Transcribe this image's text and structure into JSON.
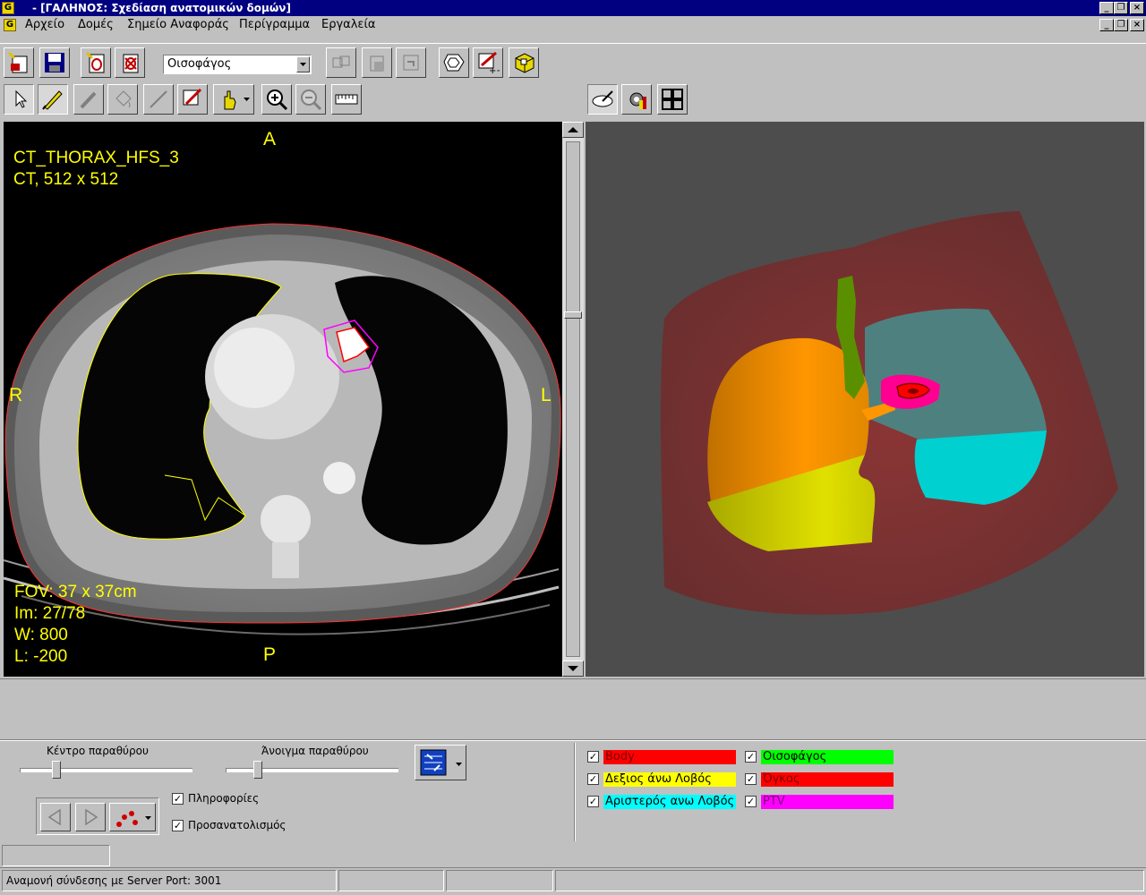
{
  "window": {
    "title": "- [ΓΑΛΗΝΟΣ: Σχεδίαση ανατομικών δομών]"
  },
  "menu": [
    "Αρχείο",
    "Δομές",
    "Σημείο Αναφοράς",
    "Περίγραμμα",
    "Εργαλεία"
  ],
  "toolbar": {
    "structure_select": "Οισοφάγος"
  },
  "ct_view": {
    "series": "CT_THORAX_HFS_3",
    "info": "CT, 512 x 512",
    "orient_top": "A",
    "orient_bottom": "P",
    "orient_left": "R",
    "orient_right": "L",
    "fov": "FOV: 37 x 37cm",
    "image": "Im: 27/78",
    "width": "W: 800",
    "level": "L: -200"
  },
  "window_controls": {
    "center_label": "Κέντρο παραθύρου",
    "width_label": "Άνοιγμα παραθύρου",
    "center_position": 0.2,
    "width_position": 0.17
  },
  "options": {
    "info_label": "Πληροφορίες",
    "orientation_label": "Προσανατολισμός"
  },
  "structures": [
    {
      "name": "Body",
      "color": "#ff0000",
      "text_color": "#7a0000"
    },
    {
      "name": "Οισοφάγος",
      "color": "#00ff00",
      "text_color": "#000000"
    },
    {
      "name": "Δεξιος άνω Λοβός",
      "color": "#ffff00",
      "text_color": "#000000"
    },
    {
      "name": "Όγκος",
      "color": "#ff0000",
      "text_color": "#7a0000"
    },
    {
      "name": "Αριστερός ανω Λοβός",
      "color": "#00ffff",
      "text_color": "#000000"
    },
    {
      "name": "PTV",
      "color": "#ff00ff",
      "text_color": "#800080"
    }
  ],
  "status": {
    "message": "Αναμονή σύνδεσης με Server Port: 3001"
  }
}
